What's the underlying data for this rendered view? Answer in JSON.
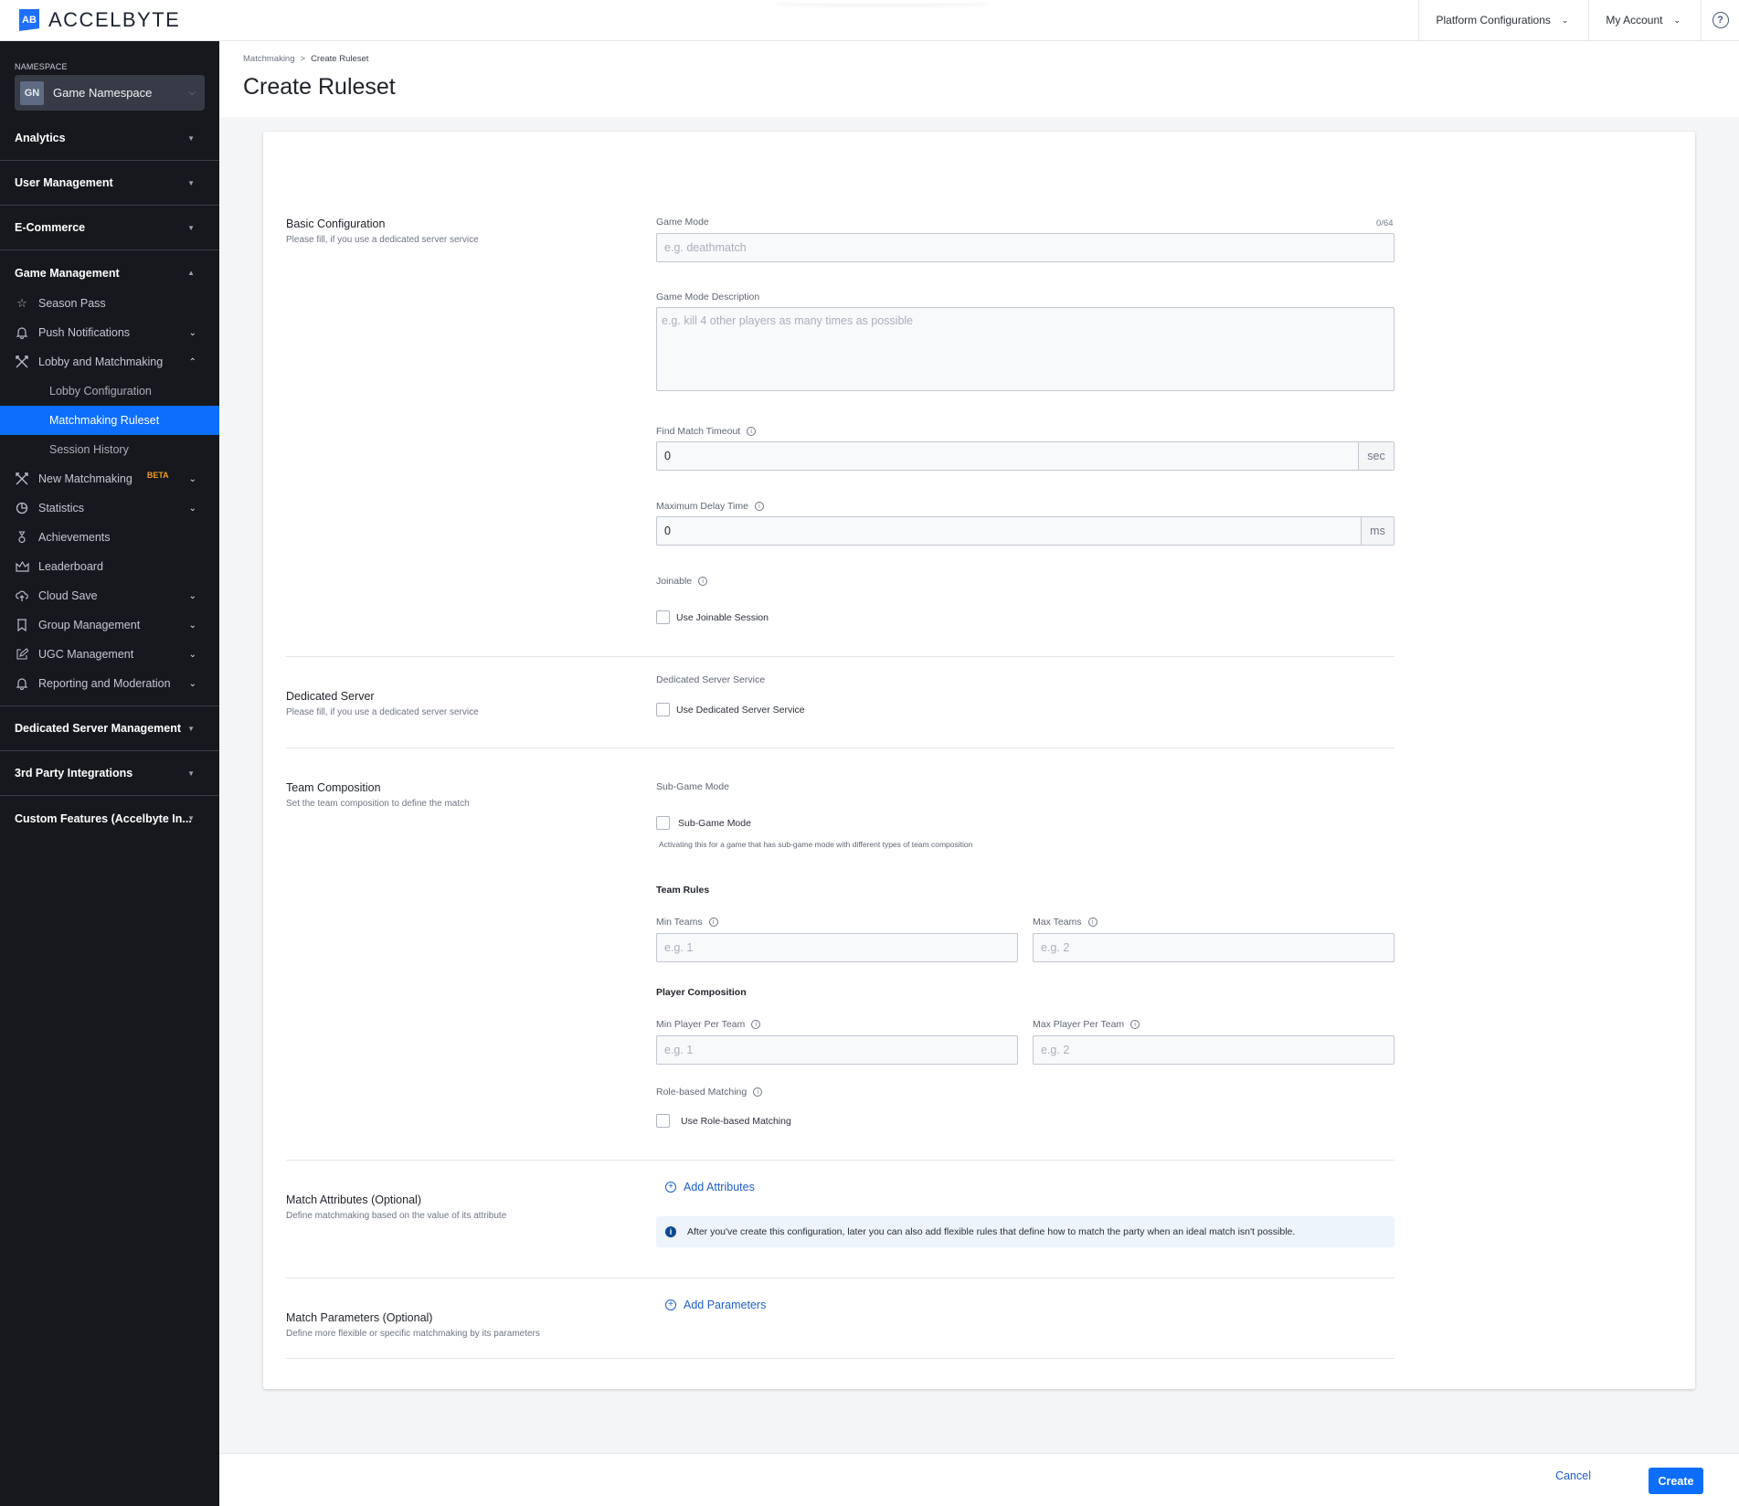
{
  "topbar": {
    "logo_mark": "AB",
    "logo_text": "ACCELBYTE",
    "menus": [
      {
        "label": "Platform Configurations"
      },
      {
        "label": "My Account"
      }
    ],
    "help_glyph": "?"
  },
  "sidebar": {
    "namespace_label": "NAMESPACE",
    "namespace_badge": "GN",
    "namespace_name": "Game Namespace",
    "groups": [
      {
        "label": "Analytics",
        "expanded": false
      },
      {
        "label": "User Management",
        "expanded": false
      },
      {
        "label": "E-Commerce",
        "expanded": false
      },
      {
        "label": "Game Management",
        "expanded": true
      },
      {
        "label": "Dedicated Server Management",
        "expanded": false
      },
      {
        "label": "3rd Party Integrations",
        "expanded": false
      },
      {
        "label": "Custom Features (Accelbyte In...",
        "expanded": false
      }
    ],
    "items": [
      {
        "label": "Season Pass",
        "icon": "star-icon"
      },
      {
        "label": "Push Notifications",
        "icon": "bell-icon"
      },
      {
        "label": "Lobby and Matchmaking",
        "icon": "crossed-swords-icon"
      },
      {
        "label": "New Matchmaking",
        "icon": "crossed-swords-icon",
        "badge": "BETA"
      },
      {
        "label": "Statistics",
        "icon": "pie-chart-icon"
      },
      {
        "label": "Achievements",
        "icon": "medal-icon"
      },
      {
        "label": "Leaderboard",
        "icon": "crown-icon"
      },
      {
        "label": "Cloud Save",
        "icon": "cloud-upload-icon"
      },
      {
        "label": "Group Management",
        "icon": "banner-icon"
      },
      {
        "label": "UGC Management",
        "icon": "edit-icon"
      },
      {
        "label": "Reporting and Moderation",
        "icon": "bell-icon"
      }
    ],
    "subitems": [
      {
        "label": "Lobby Configuration",
        "active": false
      },
      {
        "label": "Matchmaking Ruleset",
        "active": true
      },
      {
        "label": "Session History",
        "active": false
      }
    ]
  },
  "header": {
    "breadcrumb": [
      "Matchmaking",
      "Create Ruleset"
    ],
    "breadcrumb_sep": ">",
    "title": "Create Ruleset"
  },
  "form": {
    "basic": {
      "title": "Basic Configuration",
      "desc": "Please fill, if you use a dedicated server service",
      "game_mode_label": "Game Mode",
      "game_mode_counter": "0/64",
      "game_mode_placeholder": "e.g. deathmatch",
      "game_mode_value": "",
      "desc_label": "Game Mode Description",
      "desc_placeholder": "e.g. kill 4 other players as many times as possible",
      "timeout_label": "Find Match Timeout",
      "timeout_value": "0",
      "timeout_unit": "sec",
      "delay_label": "Maximum Delay Time",
      "delay_value": "0",
      "delay_unit": "ms",
      "joinable_label": "Joinable",
      "joinable_check": "Use Joinable Session",
      "joinable_checked": false
    },
    "dedicated": {
      "title": "Dedicated Server",
      "desc": "Please fill, if you use a dedicated server service",
      "label": "Dedicated Server Service",
      "check": "Use Dedicated Server Service",
      "checked": false
    },
    "team": {
      "title": "Team Composition",
      "desc": "Set the team composition to define the match",
      "sub_label": "Sub-Game Mode",
      "sub_check": "Sub-Game Mode",
      "sub_checked": false,
      "sub_hint": "Activating this for a game that has sub-game mode with different types of team composition",
      "team_rules": "Team Rules",
      "min_teams_label": "Min Teams",
      "min_teams_placeholder": "e.g. 1",
      "max_teams_label": "Max Teams",
      "max_teams_placeholder": "e.g. 2",
      "player_comp": "Player Composition",
      "min_player_label": "Min Player Per Team",
      "min_player_placeholder": "e.g. 1",
      "max_player_label": "Max Player Per Team",
      "max_player_placeholder": "e.g. 2",
      "role_label": "Role-based Matching",
      "role_check": "Use Role-based Matching",
      "role_checked": false
    },
    "attributes": {
      "title": "Match Attributes (Optional)",
      "desc": "Define matchmaking based on the value of its attribute",
      "add": "Add Attributes",
      "info": "After you've create this configuration, later you can also add flexible rules that define how to match the party when an ideal match isn't possible."
    },
    "parameters": {
      "title": "Match Parameters (Optional)",
      "desc": "Define more flexible or specific matchmaking by its parameters",
      "add": "Add Parameters"
    }
  },
  "footer": {
    "cancel": "Cancel",
    "create": "Create"
  },
  "colors": {
    "accent": "#0d6efd",
    "sidebar_bg": "#16181d",
    "link": "#1f5fcf",
    "beta": "#f39c1e"
  }
}
